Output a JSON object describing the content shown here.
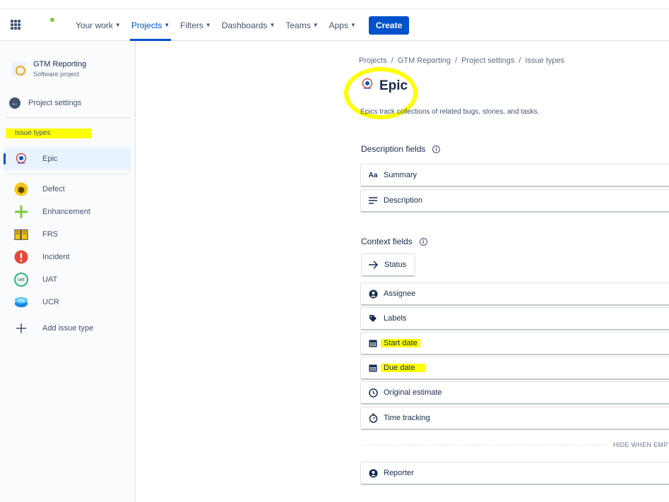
{
  "nav": {
    "items": [
      {
        "label": "Your work",
        "active": false
      },
      {
        "label": "Projects",
        "active": true
      },
      {
        "label": "Filters",
        "active": false
      },
      {
        "label": "Dashboards",
        "active": false
      },
      {
        "label": "Teams",
        "active": false
      },
      {
        "label": "Apps",
        "active": false
      }
    ],
    "create_label": "Create"
  },
  "sidebar": {
    "project_name": "GTM Reporting",
    "project_type": "Software project",
    "back_label": "Project settings",
    "section_title": "Issue types",
    "items": [
      {
        "label": "Epic",
        "icon": "epic-icon",
        "selected": true
      },
      {
        "label": "Defect",
        "icon": "bug-icon"
      },
      {
        "label": "Enhancement",
        "icon": "plus-icon"
      },
      {
        "label": "FRS",
        "icon": "book-icon"
      },
      {
        "label": "Incident",
        "icon": "alert-icon"
      },
      {
        "label": "UAT",
        "icon": "uat-icon"
      },
      {
        "label": "UCR",
        "icon": "ucr-icon"
      }
    ],
    "add_label": "Add issue type"
  },
  "main": {
    "breadcrumb": [
      "Projects",
      "GTM Reporting",
      "Project settings",
      "Issue types"
    ],
    "title": "Epic",
    "description": "Epics track collections of related bugs, stories, and tasks.",
    "description_fields_title": "Description fields",
    "description_fields": [
      {
        "label": "Summary",
        "icon": "text-icon"
      },
      {
        "label": "Description",
        "icon": "lines-icon"
      }
    ],
    "context_fields_title": "Context fields",
    "status_label": "Status",
    "context_fields": [
      {
        "label": "Assignee",
        "icon": "person-icon"
      },
      {
        "label": "Labels",
        "icon": "tag-icon"
      },
      {
        "label": "Start date",
        "icon": "calendar-icon"
      },
      {
        "label": "Due date",
        "icon": "calendar-icon"
      },
      {
        "label": "Original estimate",
        "icon": "clock-icon"
      },
      {
        "label": "Time tracking",
        "icon": "stopwatch-icon"
      }
    ],
    "hide_when_empty": "HIDE WHEN EMPT",
    "hidden_fields": [
      {
        "label": "Reporter",
        "icon": "person-icon"
      }
    ]
  },
  "colors": {
    "accent": "#0052cc",
    "highlight": "#ffff00",
    "text": "#172b4d"
  }
}
